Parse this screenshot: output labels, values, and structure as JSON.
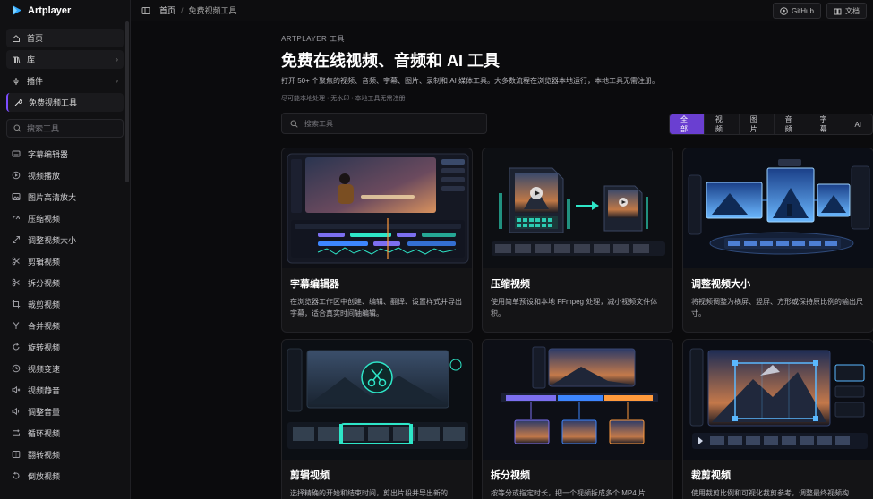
{
  "brand": {
    "name": "Artplayer"
  },
  "topbar": {
    "breadcrumb_home": "首页",
    "breadcrumb_sep": "/",
    "breadcrumb_current": "免费视频工具",
    "github_label": "GitHub",
    "docs_label": "文档"
  },
  "sidebar": {
    "nav": [
      {
        "label": "首页",
        "icon": "home-icon"
      },
      {
        "label": "库",
        "icon": "library-icon",
        "has_children": true
      },
      {
        "label": "插件",
        "icon": "plugin-icon",
        "has_children": true
      },
      {
        "label": "免费视频工具",
        "icon": "wrench-icon",
        "active": true
      }
    ],
    "search_placeholder": "搜索工具",
    "tools": [
      {
        "label": "字幕编辑器",
        "icon": "subtitle-icon"
      },
      {
        "label": "视频播放",
        "icon": "play-icon"
      },
      {
        "label": "图片高清放大",
        "icon": "image-icon"
      },
      {
        "label": "压缩视频",
        "icon": "compress-icon"
      },
      {
        "label": "调整视频大小",
        "icon": "resize-icon"
      },
      {
        "label": "剪辑视频",
        "icon": "scissors-icon"
      },
      {
        "label": "拆分视频",
        "icon": "split-icon"
      },
      {
        "label": "裁剪视频",
        "icon": "crop-icon"
      },
      {
        "label": "合并视频",
        "icon": "merge-icon"
      },
      {
        "label": "旋转视频",
        "icon": "rotate-icon"
      },
      {
        "label": "视频变速",
        "icon": "speed-icon"
      },
      {
        "label": "视频静音",
        "icon": "mute-icon"
      },
      {
        "label": "调整音量",
        "icon": "volume-icon"
      },
      {
        "label": "循环视频",
        "icon": "loop-icon"
      },
      {
        "label": "翻转视频",
        "icon": "flip-icon"
      },
      {
        "label": "倒放视频",
        "icon": "reverse-icon"
      }
    ]
  },
  "main": {
    "eyebrow": "ARTPLAYER 工具",
    "title": "免费在线视频、音频和 AI 工具",
    "description": "打开 50+ 个聚焦的视频、音频、字幕、图片、录制和 AI 媒体工具。大多数流程在浏览器本地运行，本地工具无需注册。",
    "subdescription": "尽可能本地处理 · 无水印 · 本地工具无需注册",
    "search_placeholder": "搜索工具",
    "filters": [
      "全部",
      "视频",
      "图片",
      "音频",
      "字幕",
      "AI"
    ],
    "cards": [
      {
        "title": "字幕编辑器",
        "desc": "在浏览器工作区中创建、编辑、翻译、设置样式并导出字幕，适合真实时间轴编辑。"
      },
      {
        "title": "压缩视频",
        "desc": "使用简单预设和本地 FFmpeg 处理，减小视频文件体积。"
      },
      {
        "title": "调整视频大小",
        "desc": "将视频调整为横屏、竖屏、方形或保持原比例的输出尺寸。"
      },
      {
        "title": "剪辑视频",
        "desc": "选择精确的开始和结束时间，剪出片段并导出新的"
      },
      {
        "title": "拆分视频",
        "desc": "按等分或指定时长，把一个视频拆成多个 MP4 片"
      },
      {
        "title": "裁剪视频",
        "desc": "使用裁剪比例和可视化裁剪参考，调整最终视频构"
      }
    ]
  },
  "colors": {
    "accent": "#6a3fd1",
    "background": "#0b0b0d",
    "sidebar": "#111113",
    "teal": "#2ee6c8"
  }
}
